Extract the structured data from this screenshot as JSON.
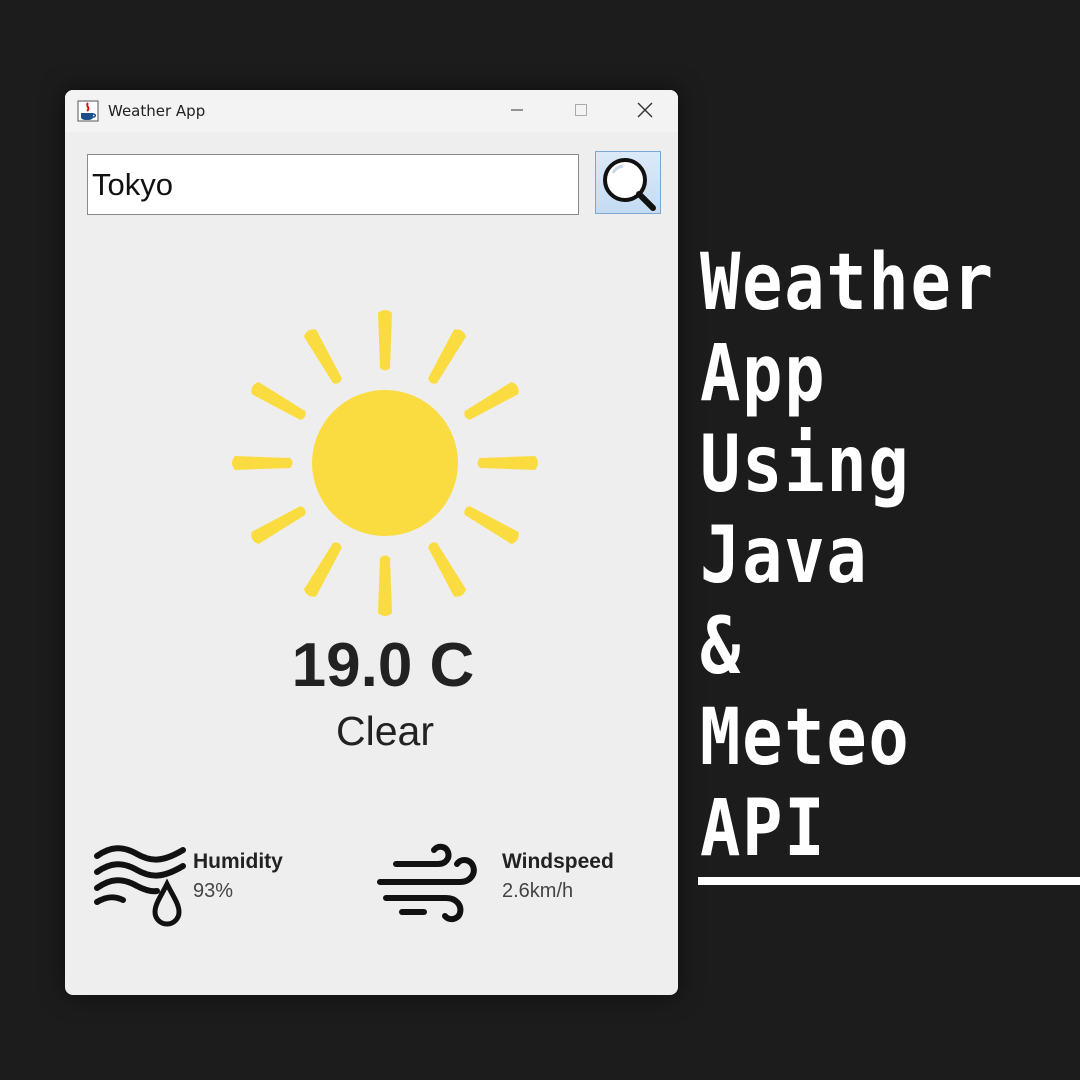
{
  "window": {
    "title": "Weather App",
    "controls": {
      "minimize": "minimize",
      "maximize": "maximize",
      "close": "close"
    }
  },
  "search": {
    "value": "Tokyo",
    "button_icon": "search-icon"
  },
  "weather": {
    "condition_icon": "sun-icon",
    "temperature": "19.0 C",
    "condition": "Clear"
  },
  "stats": {
    "humidity": {
      "icon": "humidity-icon",
      "label": "Humidity",
      "value": "93%"
    },
    "windspeed": {
      "icon": "wind-icon",
      "label": "Windspeed",
      "value": "2.6km/h"
    }
  },
  "caption": {
    "lines": [
      "Weather",
      "App",
      "Using",
      "Java",
      "&",
      "Meteo",
      "API"
    ]
  },
  "colors": {
    "background": "#1c1c1c",
    "window": "#eeeeee",
    "sun": "#fbdc40",
    "caption_text": "#ffffff"
  }
}
